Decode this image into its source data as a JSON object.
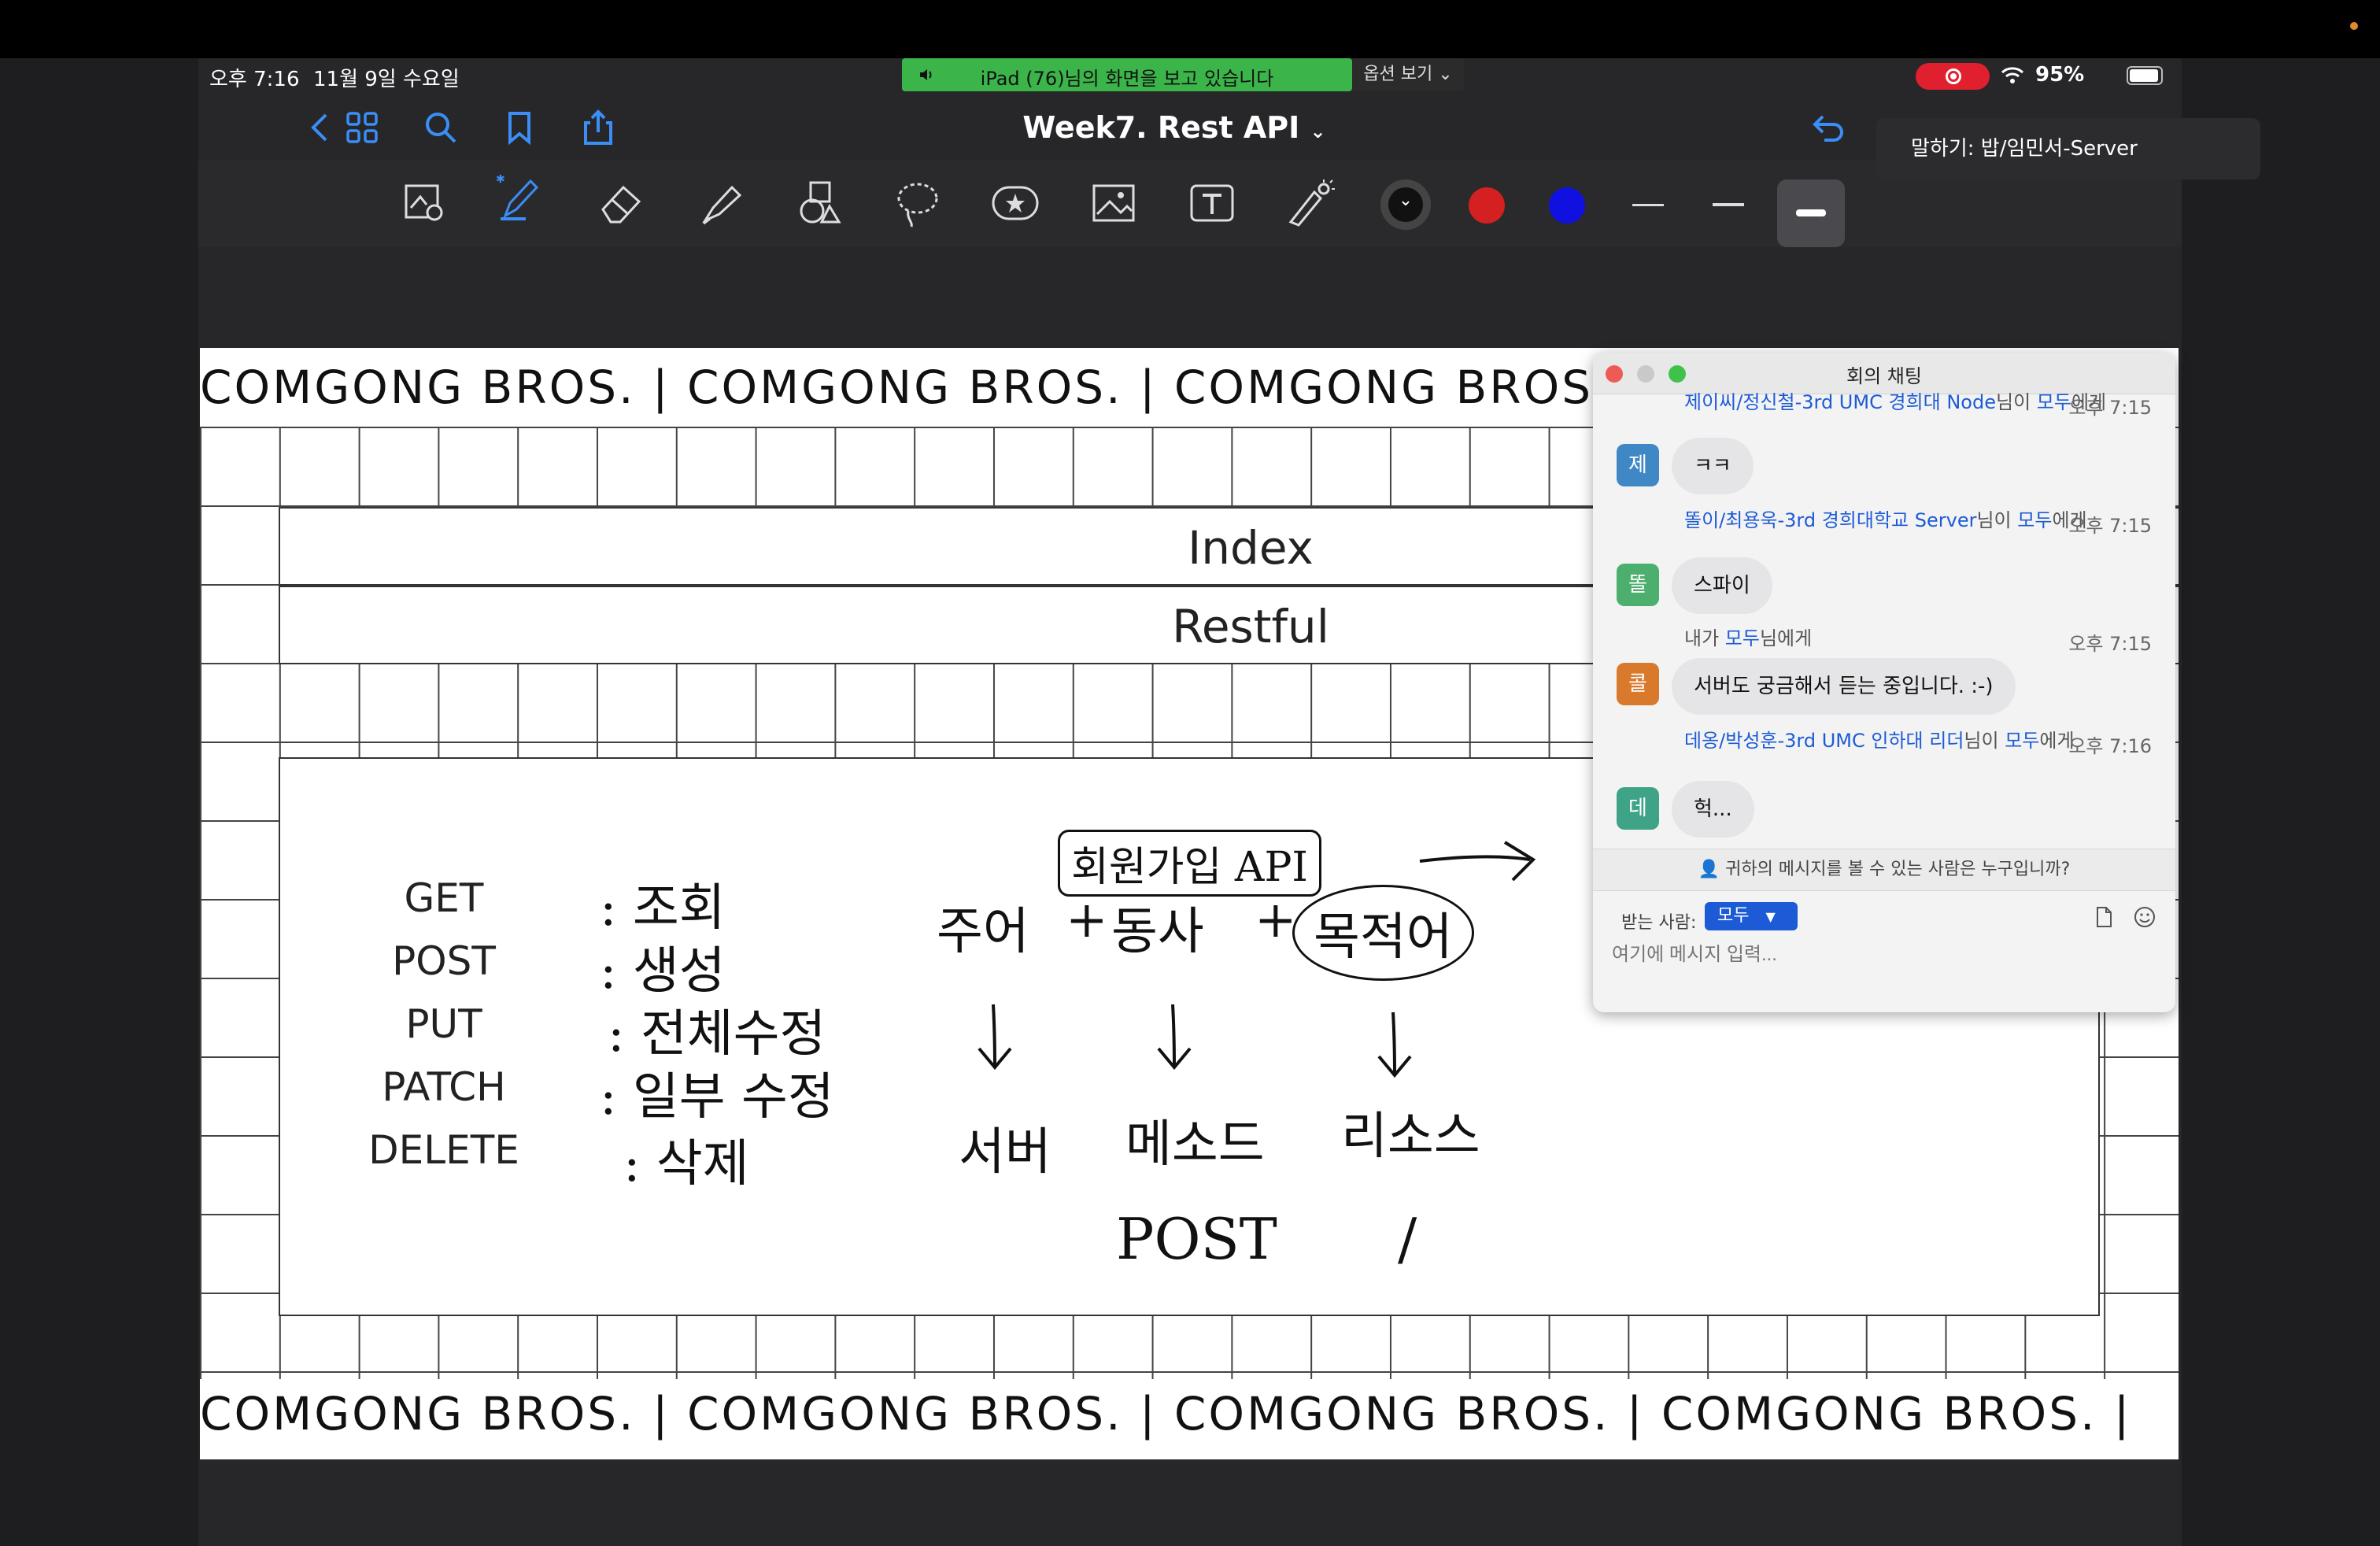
{
  "status": {
    "time": "오후 7:16",
    "date": "11월 9일 수요일",
    "sharing_text": "iPad (76)님의 화면을 보고 있습니다",
    "options_label": "옵션 보기",
    "battery": "95%"
  },
  "nav": {
    "doc_title": "Week7. Rest API",
    "speaking_tooltip": "말하기: 밥/임민서-Server"
  },
  "toolbar": {
    "colors": [
      "#111111",
      "#d42020",
      "#1010e0"
    ]
  },
  "page": {
    "banner_text": "COMGONG BROS.  |  COMGONG BROS.  |  COMGONG BROS.  |  COMGONG BROS.  |",
    "index_title": "Index",
    "restful_title": "Restful",
    "methods": [
      {
        "name": "GET",
        "desc": ": 조회"
      },
      {
        "name": "POST",
        "desc": ": 생성"
      },
      {
        "name": "PUT",
        "desc": ": 전체수정"
      },
      {
        "name": "PATCH",
        "desc": ": 일부 수정"
      },
      {
        "name": "DELETE",
        "desc": ": 삭제"
      }
    ],
    "handwriting": {
      "api_title": "회원가입 API",
      "subject": "주어",
      "verb": "동사",
      "object": "목적어",
      "server": "서버",
      "method": "메소드",
      "resource": "리소스",
      "post": "POST",
      "slash": "/",
      "plus1": "+",
      "plus2": "+"
    }
  },
  "chat": {
    "title": "회의 채팅",
    "messages": [
      {
        "avatar": "제",
        "avatar_color": "#3f88c5",
        "sender": "제이씨/정신철-3rd UMC 경희대 Node",
        "suffix": "님이 ",
        "to": "모두",
        "to_suffix": "에게",
        "time": "오후 7:15",
        "text": "ㅋㅋ"
      },
      {
        "avatar": "똘",
        "avatar_color": "#4caf6d",
        "sender": "똘이/최용욱-3rd 경희대학교 Server",
        "suffix": "님이 ",
        "to": "모두",
        "to_suffix": "에게",
        "time": "오후 7:15",
        "text": "스파이"
      },
      {
        "avatar": "콜",
        "avatar_color": "#d9792b",
        "sender": "내가 ",
        "suffix": "",
        "to": "모두",
        "to_suffix": "님에게",
        "time": "오후 7:15",
        "text": "서버도 궁금해서 듣는 중입니다. :-)"
      },
      {
        "avatar": "데",
        "avatar_color": "#3fa387",
        "sender": "데옹/박성훈-3rd UMC 인하대 리더",
        "suffix": "님이 ",
        "to": "모두",
        "to_suffix": "에게",
        "time": "오후 7:16",
        "text": "헉..."
      }
    ],
    "who_sees": "귀하의 메시지를 볼 수 있는 사람은 누구입니까?",
    "to_label": "받는 사람:",
    "to_value": "모두",
    "input_placeholder": "여기에 메시지 입력..."
  }
}
